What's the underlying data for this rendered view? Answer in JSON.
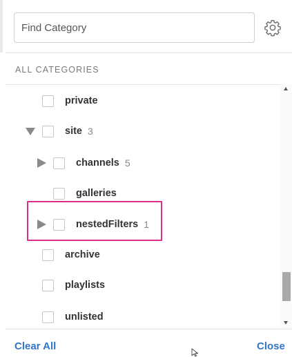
{
  "search": {
    "placeholder": "Find Category",
    "value": ""
  },
  "section": {
    "header": "ALL CATEGORIES"
  },
  "rows": [
    {
      "label": "private",
      "count": "",
      "toggle": "none"
    },
    {
      "label": "site",
      "count": "3",
      "toggle": "expanded"
    },
    {
      "label": "channels",
      "count": "5",
      "toggle": "collapsed"
    },
    {
      "label": "galleries",
      "count": "",
      "toggle": "none"
    },
    {
      "label": "nestedFilters",
      "count": "1",
      "toggle": "collapsed"
    },
    {
      "label": "archive",
      "count": "",
      "toggle": "none"
    },
    {
      "label": "playlists",
      "count": "",
      "toggle": "none"
    },
    {
      "label": "unlisted",
      "count": "",
      "toggle": "none"
    }
  ],
  "footer": {
    "clear_all": "Clear All",
    "close": "Close"
  },
  "colors": {
    "link": "#2f76c6",
    "highlight": "#d62f86",
    "toggle": "#8a8a8a"
  },
  "icons": {
    "settings": "gear-icon",
    "expanded": "triangle-down-icon",
    "collapsed": "triangle-right-icon"
  }
}
